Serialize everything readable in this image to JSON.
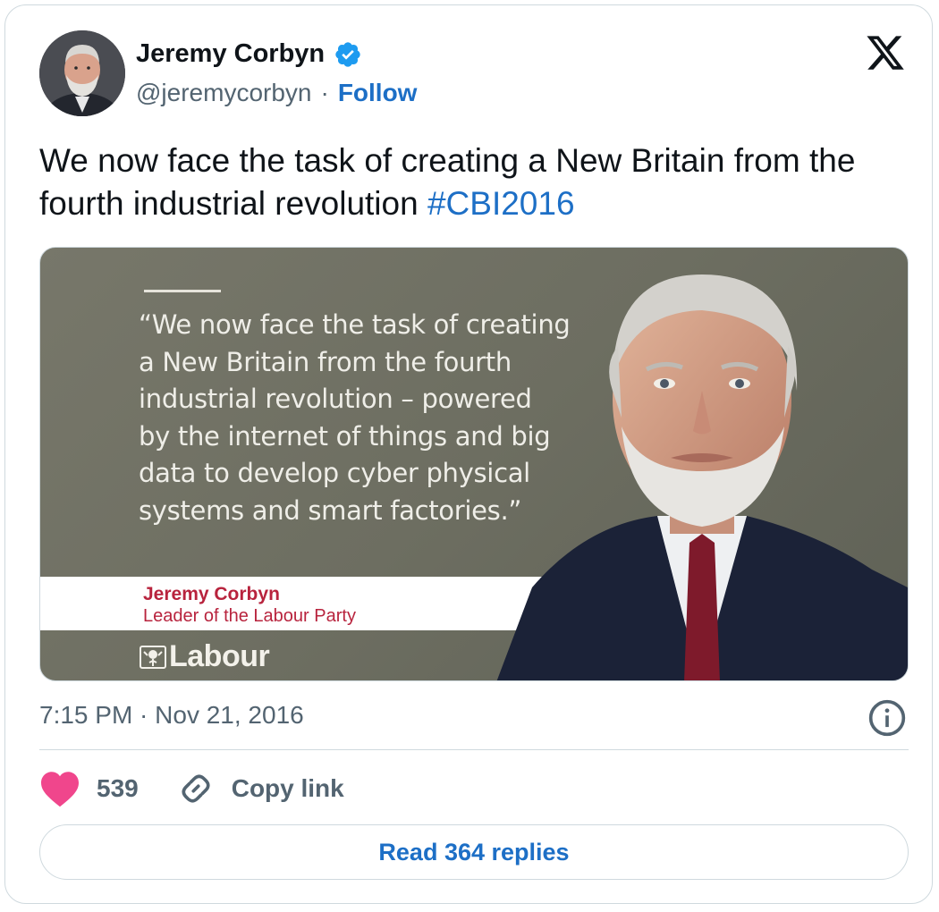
{
  "author": {
    "name": "Jeremy Corbyn",
    "handle": "@jeremycorbyn",
    "separator": "·",
    "follow_label": "Follow",
    "avatar_icon": "profile-photo-icon",
    "verified_icon": "verified-badge-icon"
  },
  "header": {
    "logo_icon": "x-logo-icon"
  },
  "tweet": {
    "text": "We now face the task of creating a New Britain from the fourth industrial revolution ",
    "hashtag": "#CBI2016"
  },
  "media": {
    "quote": "“We now face the task of creating\n a New Britain from the fourth\n industrial revolution – powered\n by the internet of things and big\n data to develop cyber physical\n systems and smart factories.”",
    "speaker_name": "Jeremy Corbyn",
    "speaker_title": "Leader of the Labour Party",
    "party_logo_text": "Labour",
    "party_logo_icon": "labour-rose-icon",
    "portrait_icon": "portrait-photo-icon"
  },
  "meta": {
    "timestamp": "7:15 PM · Nov 21, 2016",
    "info_icon": "info-icon"
  },
  "actions": {
    "like_count": "539",
    "like_icon": "heart-icon",
    "copy_link_label": "Copy link",
    "copy_link_icon": "link-icon"
  },
  "replies_button": {
    "label": "Read 364 replies"
  },
  "colors": {
    "accent": "#1d6fc6",
    "heart": "#f0468c",
    "labour_red": "#b8233d",
    "muted_text": "#536471",
    "border": "#cfd9de"
  }
}
